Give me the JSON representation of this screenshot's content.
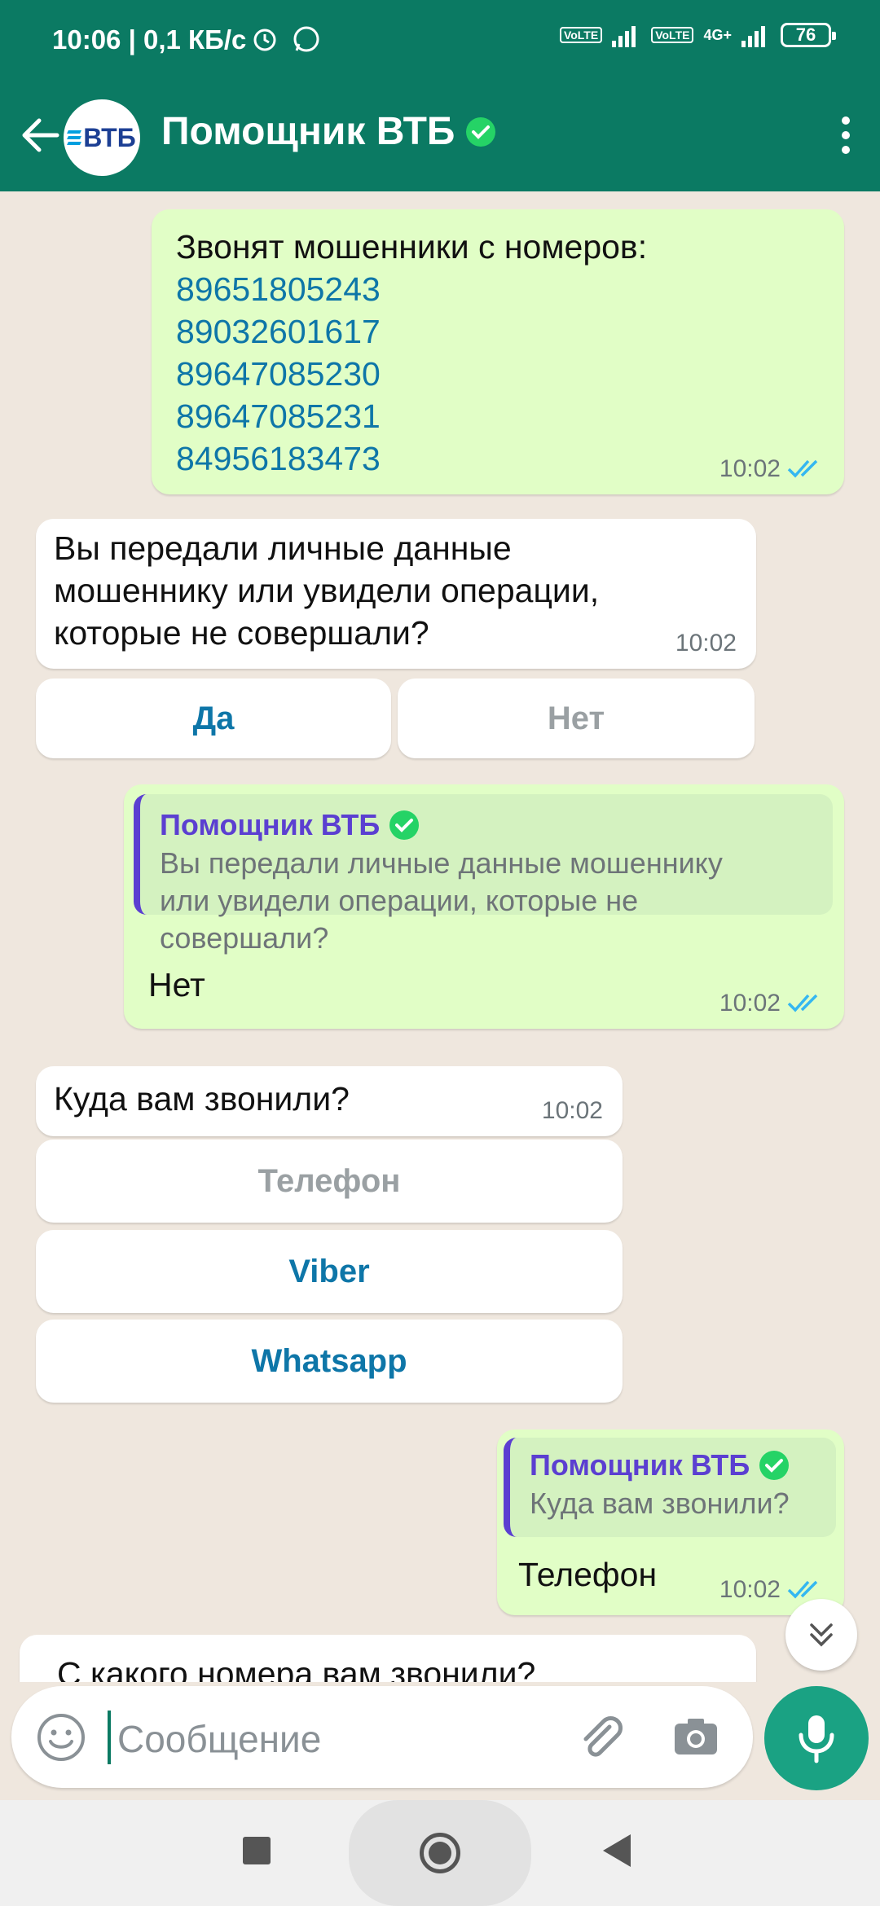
{
  "status_bar": {
    "time": "10:06",
    "speed": "| 0,1 КБ/с",
    "network1": "VoLTE",
    "network2": "VoLTE",
    "network_type": "4G+",
    "battery": "76"
  },
  "header": {
    "title": "Помощник ВТБ",
    "avatar_text": "ВТБ",
    "accent_color": "#0b7a63"
  },
  "messages": {
    "m1": {
      "text": "Звонят мошенники с номеров:",
      "numbers": [
        "89651805243",
        "89032601617",
        "89647085230",
        "89647085231",
        "84956183473"
      ],
      "time": "10:02"
    },
    "m2": {
      "line1": "Вы передали личные данные",
      "line2": "мошеннику или увидели операции,",
      "line3": "которые не совершали?",
      "time": "10:02",
      "btn_yes": "Да",
      "btn_no": "Нет"
    },
    "m3": {
      "quote_name": "Помощник ВТБ",
      "quote_line1": "Вы передали личные данные мошеннику",
      "quote_line2": "или увидели операции, которые не",
      "quote_line3": "совершали?",
      "text": "Нет",
      "time": "10:02"
    },
    "m4": {
      "text": "Куда вам звонили?",
      "time": "10:02",
      "options": [
        "Телефон",
        "Viber",
        "Whatsapp"
      ]
    },
    "m5": {
      "quote_name": "Помощник ВТБ",
      "quote_text": "Куда вам звонили?",
      "text": "Телефон",
      "time": "10:02"
    },
    "m6": {
      "text": "С какого номера вам звонили?"
    }
  },
  "input": {
    "placeholder": "Сообщение"
  }
}
